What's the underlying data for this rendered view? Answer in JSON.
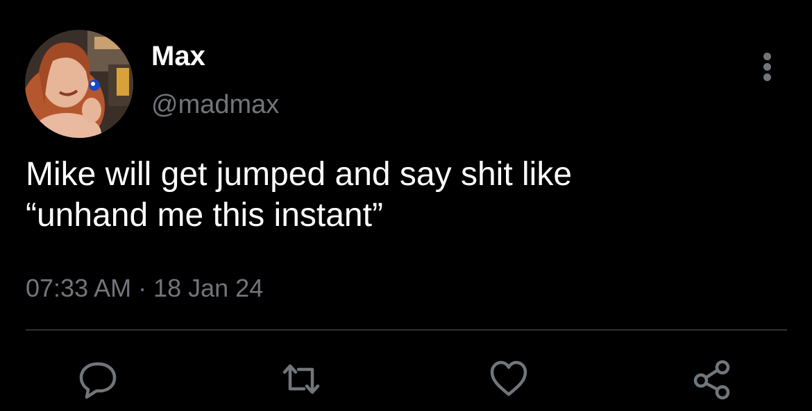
{
  "user": {
    "display_name": "Max",
    "handle": "@madmax"
  },
  "tweet": {
    "text_lines": [
      "Mike will get jumped and say shit like",
      "“unhand me this instant”"
    ],
    "timestamp": "07:33 AM · 18 Jan 24"
  },
  "actions": [
    {
      "icon": "reply-icon"
    },
    {
      "icon": "retweet-icon"
    },
    {
      "icon": "like-icon"
    },
    {
      "icon": "share-icon"
    }
  ],
  "colors": {
    "background": "#000000",
    "primary_text": "#ffffff",
    "secondary_text": "#71767b",
    "divider": "#2f3336"
  }
}
